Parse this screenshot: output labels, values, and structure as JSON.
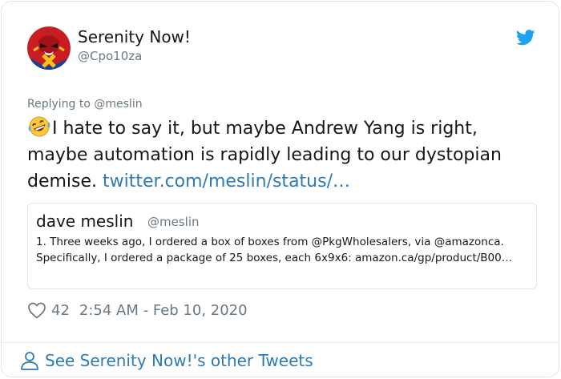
{
  "author": {
    "display_name": "Serenity Now!",
    "handle": "@Cpo10za"
  },
  "replying_to": "Replying to @meslin",
  "tweet": {
    "emoji": "rolling-on-floor-laughing-emoji",
    "text": "I hate to say it, but maybe Andrew Yang is right, maybe automation is rapidly leading to our dystopian demise. ",
    "link": "twitter.com/meslin/status/…"
  },
  "quoted_tweet": {
    "name": "dave meslin",
    "handle": "@meslin",
    "text": "1.  Three weeks ago, I ordered a box of boxes from @PkgWholesalers, via @amazonca. Specifically, I ordered a package of 25 boxes, each 6x9x6: amazon.ca/gp/product/B00…"
  },
  "meta": {
    "likes": "42",
    "timestamp": "2:54 AM - Feb 10, 2020"
  },
  "footer": {
    "label": "See Serenity Now!'s other Tweets"
  },
  "colors": {
    "link": "#2b7bb9",
    "twitter_blue": "#1da1f2",
    "muted": "#697882",
    "text": "#14171a"
  }
}
